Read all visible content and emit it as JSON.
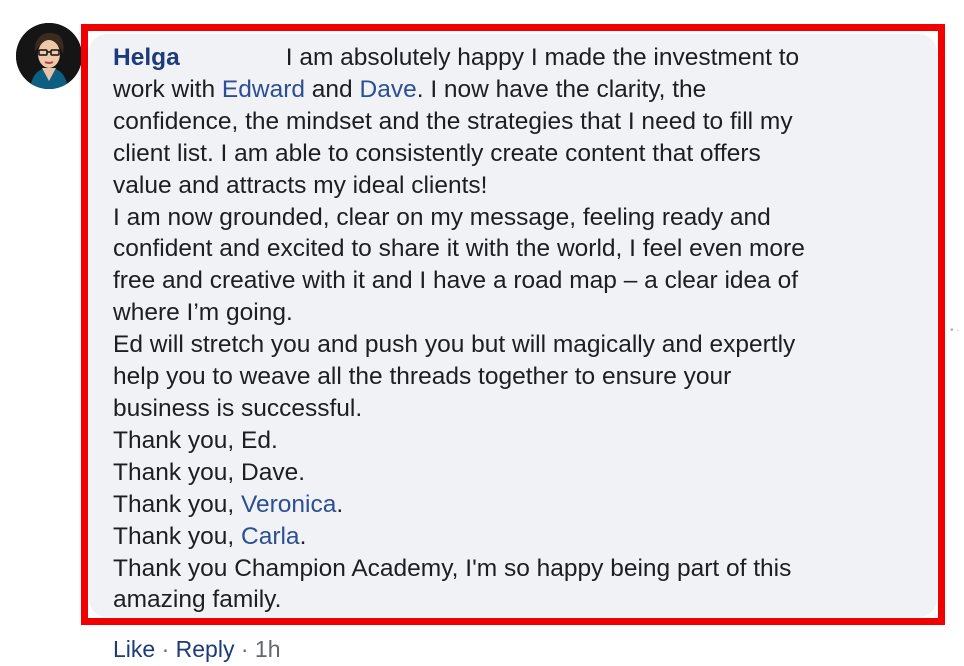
{
  "comment": {
    "author": "Helga",
    "lines": [
      {
        "parts": [
          {
            "text": "I am absolutely happy I made the investment to"
          }
        ]
      },
      {
        "parts": [
          {
            "text": "work with "
          },
          {
            "text": "Edward",
            "mention": true
          },
          {
            "text": " and "
          },
          {
            "text": "Dave",
            "mention": true
          },
          {
            "text": ". I now have the clarity, the"
          }
        ]
      },
      {
        "parts": [
          {
            "text": "confidence, the mindset and the strategies that I need to fill my"
          }
        ]
      },
      {
        "parts": [
          {
            "text": "client list. I am able to consistently create content that offers"
          }
        ]
      },
      {
        "parts": [
          {
            "text": "value and attracts my ideal clients!"
          }
        ]
      },
      {
        "parts": [
          {
            "text": "I am now grounded, clear on my message, feeling ready and"
          }
        ]
      },
      {
        "parts": [
          {
            "text": "confident and excited to share it with the world, I feel even more"
          }
        ]
      },
      {
        "parts": [
          {
            "text": "free and creative with it and I have a road map – a clear idea of"
          }
        ]
      },
      {
        "parts": [
          {
            "text": "where I’m going."
          }
        ]
      },
      {
        "parts": [
          {
            "text": "Ed will stretch you and push you but will magically and expertly"
          }
        ]
      },
      {
        "parts": [
          {
            "text": "help you to weave all the threads together to ensure your"
          }
        ]
      },
      {
        "parts": [
          {
            "text": "business is successful."
          }
        ]
      },
      {
        "parts": [
          {
            "text": "Thank you, Ed."
          }
        ]
      },
      {
        "parts": [
          {
            "text": "Thank you, Dave."
          }
        ]
      },
      {
        "parts": [
          {
            "text": "Thank you, "
          },
          {
            "text": "Veronica",
            "mention": true
          },
          {
            "text": "."
          }
        ]
      },
      {
        "parts": [
          {
            "text": "Thank you, "
          },
          {
            "text": "Carla",
            "mention": true
          },
          {
            "text": "."
          }
        ]
      },
      {
        "parts": [
          {
            "text": "Thank you Champion Academy, I'm so happy being part of this"
          }
        ]
      },
      {
        "parts": [
          {
            "text": "amazing family."
          }
        ]
      }
    ]
  },
  "actions": {
    "like_label": "Like",
    "separator": "·",
    "reply_label": "Reply",
    "timestamp": "1h"
  },
  "colors": {
    "author": "#1d3b7a",
    "mention": "#2c4f93",
    "bubble": "#f0f2f5",
    "highlight_border": "#f00000"
  },
  "icons": {
    "avatar": "profile-photo",
    "side": "more-dots-icon"
  }
}
